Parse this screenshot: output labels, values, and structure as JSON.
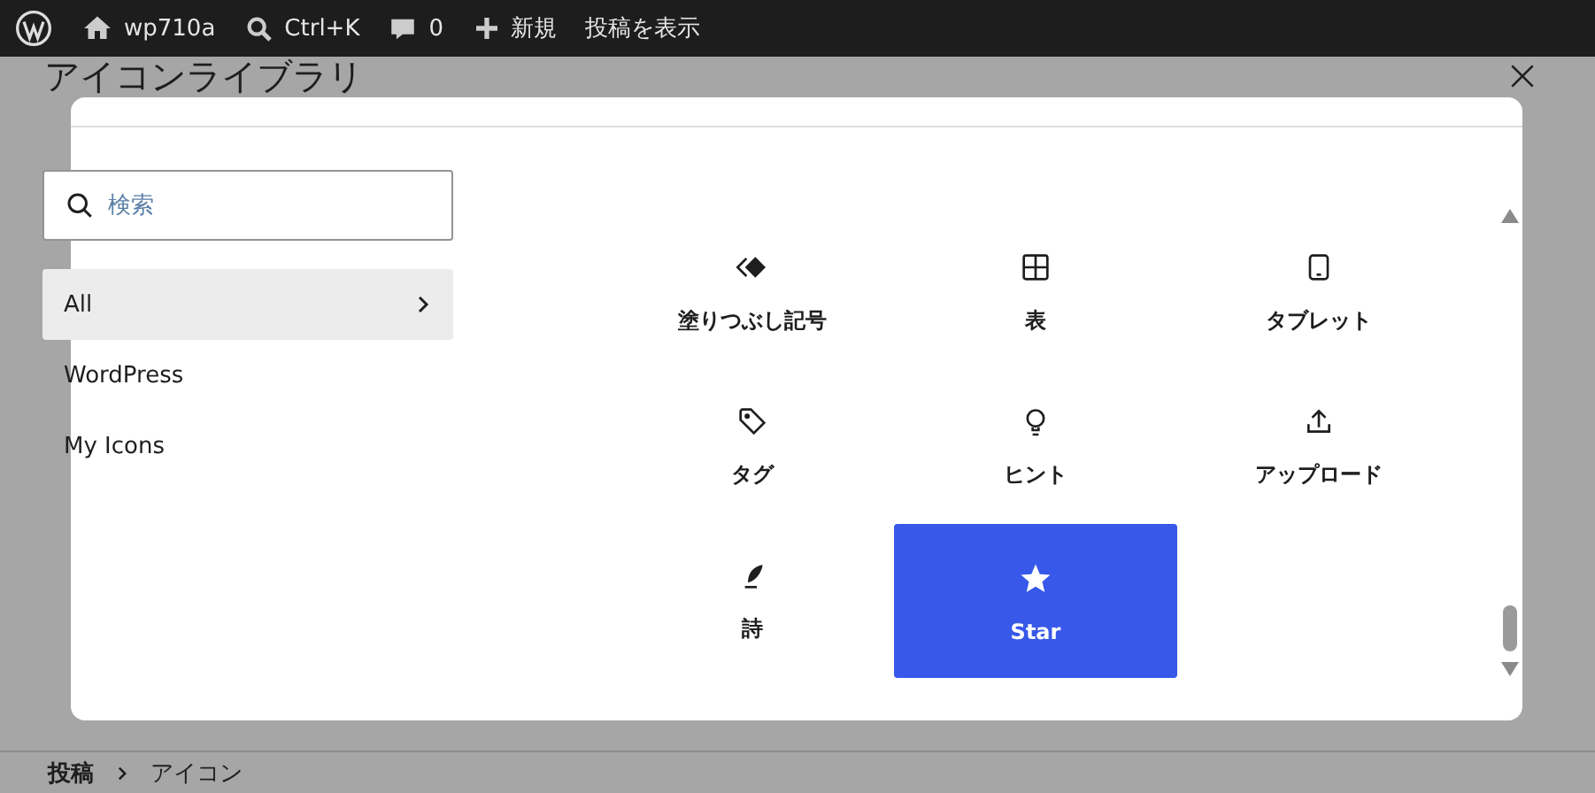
{
  "admin_bar": {
    "site": "wp710a",
    "search": "Ctrl+K",
    "comments": "0",
    "new": "新規",
    "view": "投稿を表示"
  },
  "page_title": "アイコンライブラリ",
  "modal": {
    "search": {
      "placeholder": "検索"
    },
    "categories": [
      {
        "label": "All",
        "selected": true
      },
      {
        "label": "WordPress",
        "selected": false
      },
      {
        "label": "My Icons",
        "selected": false
      }
    ],
    "icons": [
      {
        "kind": "diamond",
        "label": "塗りつぶし記号",
        "selected": false
      },
      {
        "kind": "table",
        "label": "表",
        "selected": false
      },
      {
        "kind": "tablet",
        "label": "タブレット",
        "selected": false
      },
      {
        "kind": "tag",
        "label": "タグ",
        "selected": false
      },
      {
        "kind": "bulb",
        "label": "ヒント",
        "selected": false
      },
      {
        "kind": "upload",
        "label": "アップロード",
        "selected": false
      },
      {
        "kind": "feather",
        "label": "詩",
        "selected": false
      },
      {
        "kind": "star",
        "label": "Star",
        "selected": true
      }
    ]
  },
  "breadcrumb": [
    "投稿",
    "アイコン"
  ]
}
